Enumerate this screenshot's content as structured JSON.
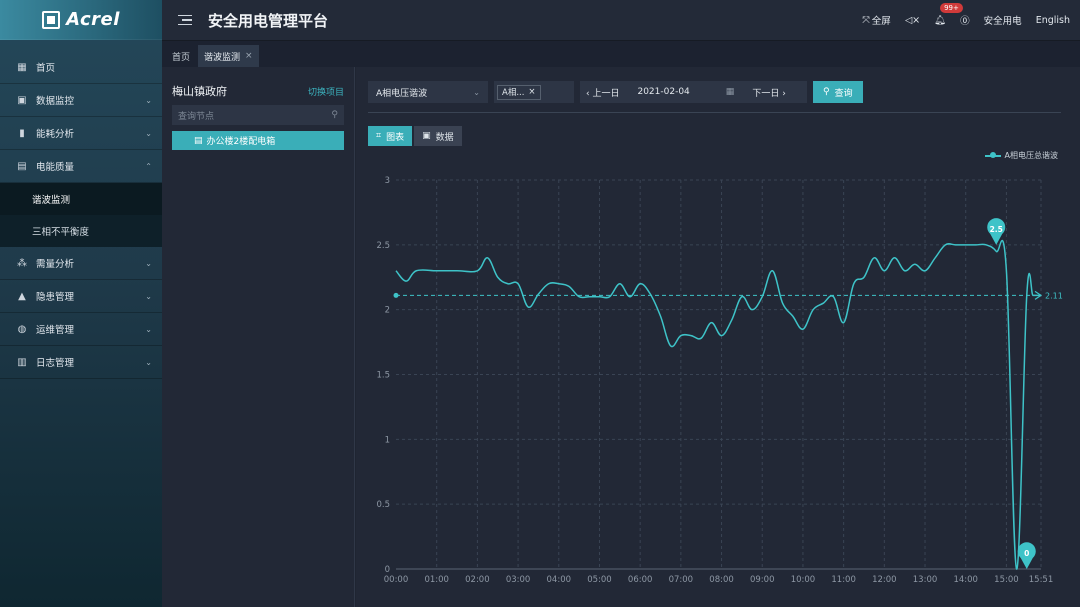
{
  "app": {
    "logo_text": "Acrel",
    "title": "安全用电管理平台"
  },
  "header": {
    "fullscreen_label": "全屏",
    "notification_count": "99+",
    "user_label": "安全用电",
    "language_label": "English"
  },
  "sidebar": {
    "items": [
      {
        "label": "首页",
        "icon": "home-icon"
      },
      {
        "label": "数据监控",
        "icon": "monitor-icon"
      },
      {
        "label": "能耗分析",
        "icon": "bar-chart-icon"
      },
      {
        "label": "电能质量",
        "icon": "calendar-icon"
      },
      {
        "label": "需量分析",
        "icon": "cluster-icon"
      },
      {
        "label": "隐患管理",
        "icon": "warning-icon"
      },
      {
        "label": "运维管理",
        "icon": "globe-icon"
      },
      {
        "label": "日志管理",
        "icon": "list-icon"
      }
    ],
    "subitems": [
      {
        "label": "谐波监测",
        "active": true
      },
      {
        "label": "三相不平衡度",
        "active": false
      }
    ]
  },
  "tabs": [
    {
      "label": "首页",
      "active": false
    },
    {
      "label": "谐波监测",
      "active": true
    }
  ],
  "tree": {
    "title": "梅山镇政府",
    "switch_label": "切换项目",
    "search_placeholder": "查询节点",
    "node_label": "办公楼2楼配电箱"
  },
  "filters": {
    "type_value": "A相电压谐波",
    "chip_label": "A相...",
    "prev_label": "上一日",
    "date_value": "2021-02-04",
    "next_label": "下一日",
    "query_label": "查询"
  },
  "view_tabs": [
    {
      "label": "图表",
      "active": true
    },
    {
      "label": "数据",
      "active": false
    }
  ],
  "colors": {
    "accent": "#3aaeb8",
    "series": "#3ec3c8"
  },
  "chart_data": {
    "type": "line",
    "title": "",
    "xlabel": "",
    "ylabel": "",
    "legend": [
      "A相电压总谐波"
    ],
    "legend_position": "top-right",
    "grid": true,
    "ylim": [
      0,
      3
    ],
    "yticks": [
      0,
      0.5,
      1,
      1.5,
      2,
      2.5,
      3
    ],
    "xtick_labels": [
      "00:00",
      "01:00",
      "02:00",
      "03:00",
      "04:00",
      "05:00",
      "06:00",
      "07:00",
      "08:00",
      "09:00",
      "10:00",
      "11:00",
      "12:00",
      "13:00",
      "14:00",
      "15:00",
      "15:51"
    ],
    "xtick_hours": [
      0,
      1,
      2,
      3,
      4,
      5,
      6,
      7,
      8,
      9,
      10,
      11,
      12,
      13,
      14,
      15,
      15.85
    ],
    "xlim_hours": [
      0,
      15.85
    ],
    "series": [
      {
        "name": "A相电压总谐波",
        "x_hours": [
          0,
          0.25,
          0.5,
          1,
          1.5,
          2,
          2.25,
          2.5,
          2.75,
          3,
          3.25,
          3.5,
          3.75,
          4,
          4.25,
          4.5,
          4.75,
          5,
          5.25,
          5.5,
          5.75,
          6,
          6.25,
          6.5,
          6.75,
          7,
          7.25,
          7.5,
          7.75,
          8,
          8.25,
          8.5,
          8.75,
          9,
          9.25,
          9.5,
          9.75,
          10,
          10.25,
          10.5,
          10.75,
          11,
          11.25,
          11.5,
          11.75,
          12,
          12.25,
          12.5,
          12.75,
          13,
          13.25,
          13.5,
          13.75,
          14,
          14.25,
          14.5,
          14.75,
          15,
          15.25,
          15.5,
          15.65,
          15.75,
          15.85
        ],
        "values": [
          2.3,
          2.22,
          2.3,
          2.3,
          2.3,
          2.3,
          2.4,
          2.25,
          2.2,
          2.2,
          2.02,
          2.12,
          2.2,
          2.2,
          2.18,
          2.1,
          2.1,
          2.1,
          2.1,
          2.2,
          2.1,
          2.2,
          2.12,
          1.95,
          1.72,
          1.8,
          1.8,
          1.78,
          1.9,
          1.8,
          1.92,
          2.1,
          2.0,
          2.1,
          2.3,
          2.05,
          1.95,
          1.85,
          2.0,
          2.05,
          2.1,
          1.9,
          2.2,
          2.25,
          2.4,
          2.3,
          2.4,
          2.3,
          2.35,
          2.3,
          2.4,
          2.5,
          2.5,
          2.5,
          2.5,
          2.5,
          2.45,
          2.3,
          0,
          2.11,
          2.11,
          2.11,
          2.11
        ],
        "max": {
          "hour": 14.75,
          "value": 2.5,
          "label": "2.5"
        },
        "min": {
          "hour": 15.5,
          "value": 0,
          "label": "0"
        }
      }
    ],
    "average": {
      "value": 2.11,
      "label": "2.11"
    }
  }
}
